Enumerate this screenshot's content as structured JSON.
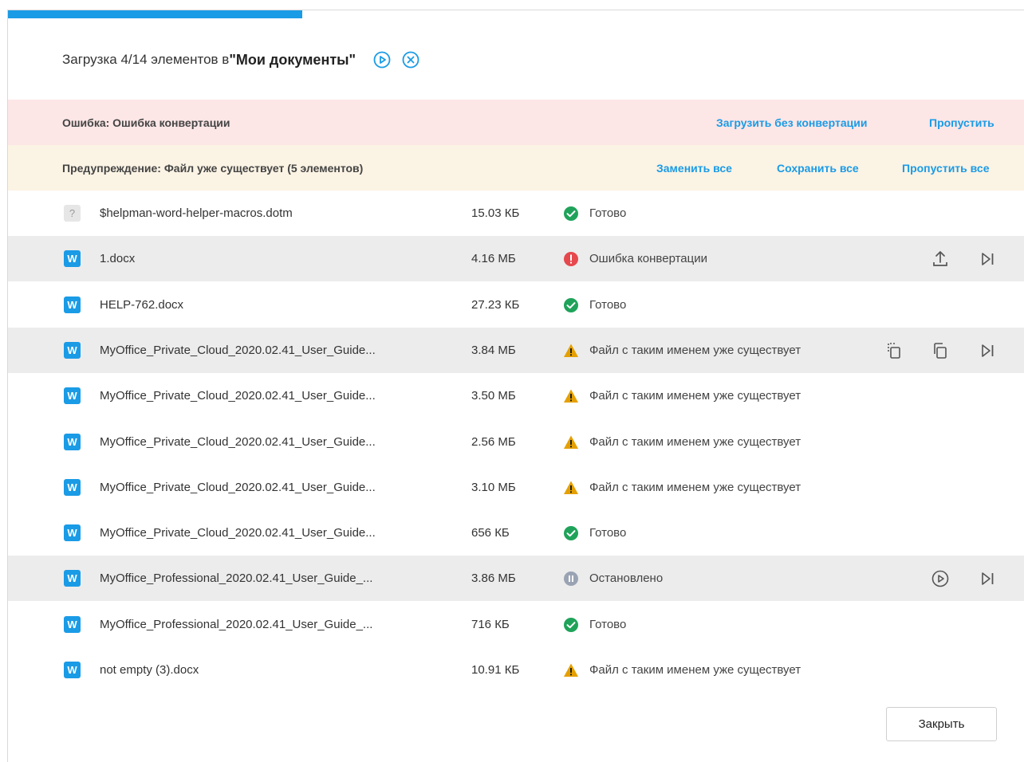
{
  "progress": {
    "fraction": 0.29,
    "color": "#1a9be6"
  },
  "header": {
    "prefix": "Загрузка 4/14 элементов в ",
    "folder": "\"Мои документы\""
  },
  "error_banner": {
    "message": "Ошибка: Ошибка конвертации",
    "action_upload": "Загрузить без конвертации",
    "action_skip": "Пропустить"
  },
  "warning_banner": {
    "message": "Предупреждение: Файл уже существует (5 элементов)",
    "action_replace_all": "Заменить все",
    "action_keep_all": "Сохранить все",
    "action_skip_all": "Пропустить все"
  },
  "files": [
    {
      "icon": "?",
      "name": "$helpman-word-helper-macros.dotm",
      "size": "15.03 КБ",
      "status": "Готово",
      "status_kind": "ok",
      "highlighted": false,
      "actions": []
    },
    {
      "icon": "W",
      "name": "1.docx",
      "size": "4.16 МБ",
      "status": "Ошибка конвертации",
      "status_kind": "error",
      "highlighted": true,
      "actions": [
        "upload-icon",
        "skip-icon"
      ]
    },
    {
      "icon": "W",
      "name": "HELP-762.docx",
      "size": "27.23 КБ",
      "status": "Готово",
      "status_kind": "ok",
      "highlighted": false,
      "actions": []
    },
    {
      "icon": "W",
      "name": "MyOffice_Private_Cloud_2020.02.41_User_Guide...",
      "size": "3.84 МБ",
      "status": "Файл с таким именем уже существует",
      "status_kind": "warning",
      "highlighted": true,
      "actions": [
        "replace-icon",
        "copy-icon",
        "skip-icon"
      ]
    },
    {
      "icon": "W",
      "name": "MyOffice_Private_Cloud_2020.02.41_User_Guide...",
      "size": "3.50 МБ",
      "status": "Файл с таким именем уже существует",
      "status_kind": "warning",
      "highlighted": false,
      "actions": []
    },
    {
      "icon": "W",
      "name": "MyOffice_Private_Cloud_2020.02.41_User_Guide...",
      "size": "2.56 МБ",
      "status": "Файл с таким именем уже существует",
      "status_kind": "warning",
      "highlighted": false,
      "actions": []
    },
    {
      "icon": "W",
      "name": "MyOffice_Private_Cloud_2020.02.41_User_Guide...",
      "size": "3.10 МБ",
      "status": "Файл с таким именем уже существует",
      "status_kind": "warning",
      "highlighted": false,
      "actions": []
    },
    {
      "icon": "W",
      "name": "MyOffice_Private_Cloud_2020.02.41_User_Guide...",
      "size": "656 КБ",
      "status": "Готово",
      "status_kind": "ok",
      "highlighted": false,
      "actions": []
    },
    {
      "icon": "W",
      "name": "MyOffice_Professional_2020.02.41_User_Guide_...",
      "size": "3.86 МБ",
      "status": "Остановлено",
      "status_kind": "paused",
      "highlighted": true,
      "actions": [
        "play-icon",
        "skip-icon"
      ]
    },
    {
      "icon": "W",
      "name": "MyOffice_Professional_2020.02.41_User_Guide_...",
      "size": "716 КБ",
      "status": "Готово",
      "status_kind": "ok",
      "highlighted": false,
      "actions": []
    },
    {
      "icon": "W",
      "name": "not empty (3).docx",
      "size": "10.91 КБ",
      "status": "Файл с таким именем уже существует",
      "status_kind": "warning",
      "highlighted": false,
      "actions": []
    }
  ],
  "footer": {
    "close_label": "Закрыть"
  },
  "colors": {
    "accent": "#1a9be6",
    "ok": "#1fa35a",
    "error": "#e5484d",
    "warning": "#e5a000",
    "paused": "#9aa3b3"
  }
}
